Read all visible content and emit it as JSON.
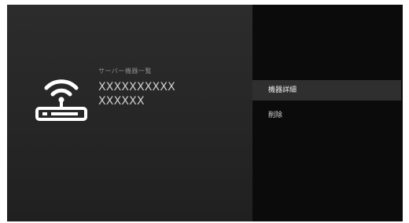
{
  "server_list": {
    "heading": "サーバー機器一覧",
    "name_line1": "XXXXXXXXXX",
    "name_line2": "XXXXXX",
    "icon": "router-wifi-icon"
  },
  "menu": {
    "items": [
      {
        "label": "機器詳細",
        "selected": true
      },
      {
        "label": "削除",
        "selected": false
      }
    ]
  },
  "colors": {
    "left_panel": "#2a2a2a",
    "right_panel": "#0b0b0b",
    "selected_item": "#2f2f2f",
    "text": "#cfcfcf"
  }
}
